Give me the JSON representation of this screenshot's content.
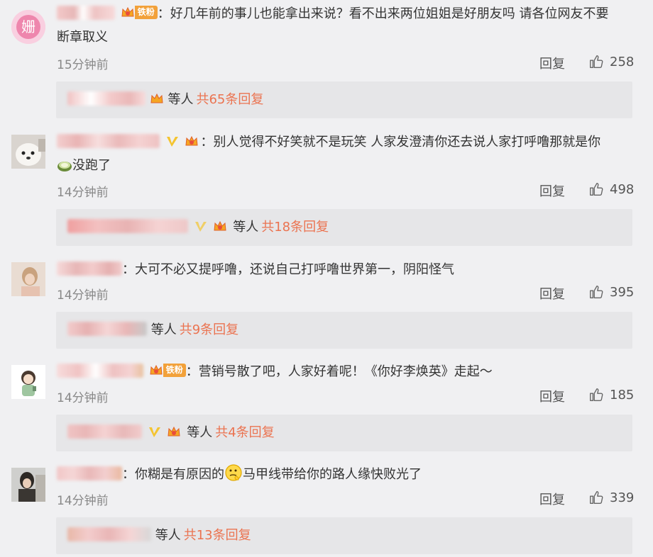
{
  "comments": [
    {
      "text_a": "好几年前的事儿也能拿出来说？看不出来两位姐姐是好朋友吗 请各位网友不要",
      "text_b": "断章取义",
      "time": "15分钟前",
      "reply_label": "回复",
      "likes": "258",
      "reply_summary_etc": "等人",
      "reply_summary_total": "共65条回复",
      "avatar_char": "姗",
      "fan_label": "铁粉"
    },
    {
      "text_a": "别人觉得不好笑就不是玩笑 人家发澄清你还去说人家打呼噜那就是你",
      "text_b": "没跑了",
      "time": "14分钟前",
      "reply_label": "回复",
      "likes": "498",
      "reply_summary_etc": "等人",
      "reply_summary_total": "共18条回复"
    },
    {
      "text_a": "大可不必又提呼噜，还说自己打呼噜世界第一，阴阳怪气",
      "time": "14分钟前",
      "reply_label": "回复",
      "likes": "395",
      "reply_summary_etc": "等人",
      "reply_summary_total": "共9条回复"
    },
    {
      "text_a": "营销号散了吧，人家好着呢！《你好李焕英》走起～",
      "time": "14分钟前",
      "reply_label": "回复",
      "likes": "185",
      "reply_summary_etc": "等人",
      "reply_summary_total": "共4条回复",
      "fan_label": "铁粉"
    },
    {
      "text_a": "你糊是有原因的",
      "text_b": "马甲线带给你的路人缘快败光了",
      "time": "14分钟前",
      "reply_label": "回复",
      "likes": "339",
      "reply_summary_etc": "等人",
      "reply_summary_total": "共13条回复"
    }
  ],
  "colors": {
    "background": "#f0f0f2",
    "reply_box": "#e6e6e8",
    "accent_orange": "#eb7350",
    "fan_badge": "#f2a13a",
    "time_gray": "#888888"
  },
  "icons": [
    "crown-icon",
    "thumbs-up-icon",
    "verified-v-icon",
    "emoji-icon"
  ]
}
